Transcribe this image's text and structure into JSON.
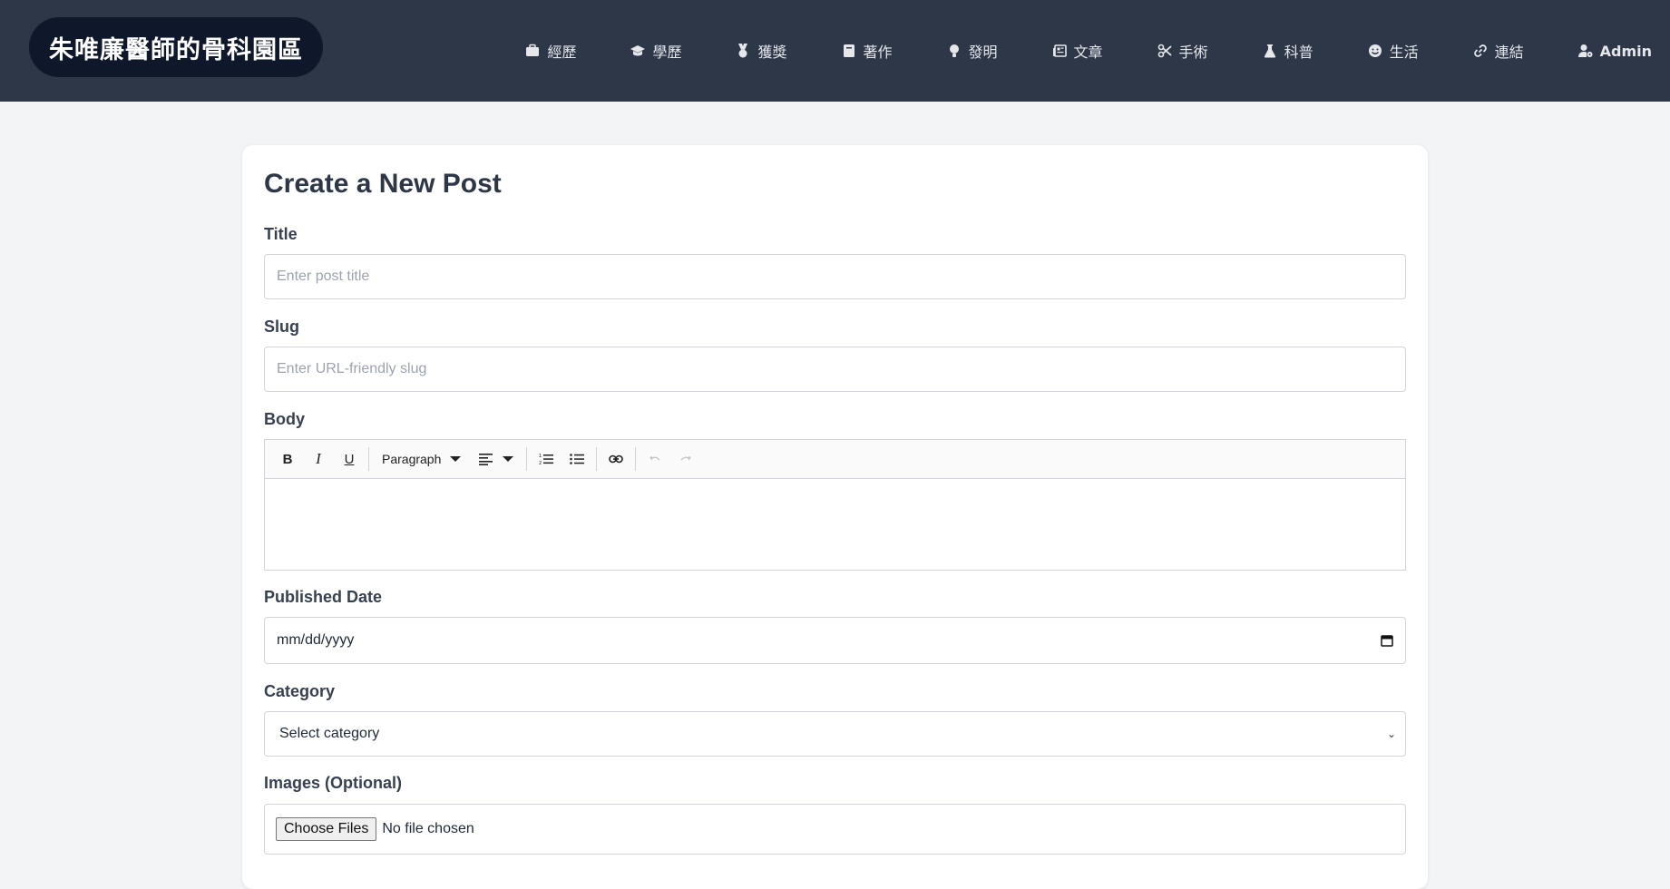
{
  "brand": {
    "title": "朱唯廉醫師的骨科園區"
  },
  "nav": {
    "items": [
      {
        "label": "經歷",
        "icon": "briefcase-icon"
      },
      {
        "label": "學歷",
        "icon": "graduation-cap-icon"
      },
      {
        "label": "獲獎",
        "icon": "medal-icon"
      },
      {
        "label": "著作",
        "icon": "book-icon"
      },
      {
        "label": "發明",
        "icon": "lightbulb-icon"
      },
      {
        "label": "文章",
        "icon": "newspaper-icon"
      },
      {
        "label": "手術",
        "icon": "scissors-icon"
      },
      {
        "label": "科普",
        "icon": "flask-icon"
      },
      {
        "label": "生活",
        "icon": "smile-icon"
      },
      {
        "label": "連結",
        "icon": "link-icon"
      },
      {
        "label": "Admin",
        "icon": "user-gear-icon"
      }
    ]
  },
  "form": {
    "heading": "Create a New Post",
    "title_label": "Title",
    "title_placeholder": "Enter post title",
    "slug_label": "Slug",
    "slug_placeholder": "Enter URL-friendly slug",
    "body_label": "Body",
    "toolbar": {
      "bold": "B",
      "italic": "I",
      "underline": "U",
      "block_format": "Paragraph"
    },
    "date_label": "Published Date",
    "date_value": "mm/dd/yyyy",
    "category_label": "Category",
    "category_value": "Select category",
    "images_label": "Images (Optional)",
    "file_button": "Choose Files",
    "file_status": "No file chosen"
  }
}
